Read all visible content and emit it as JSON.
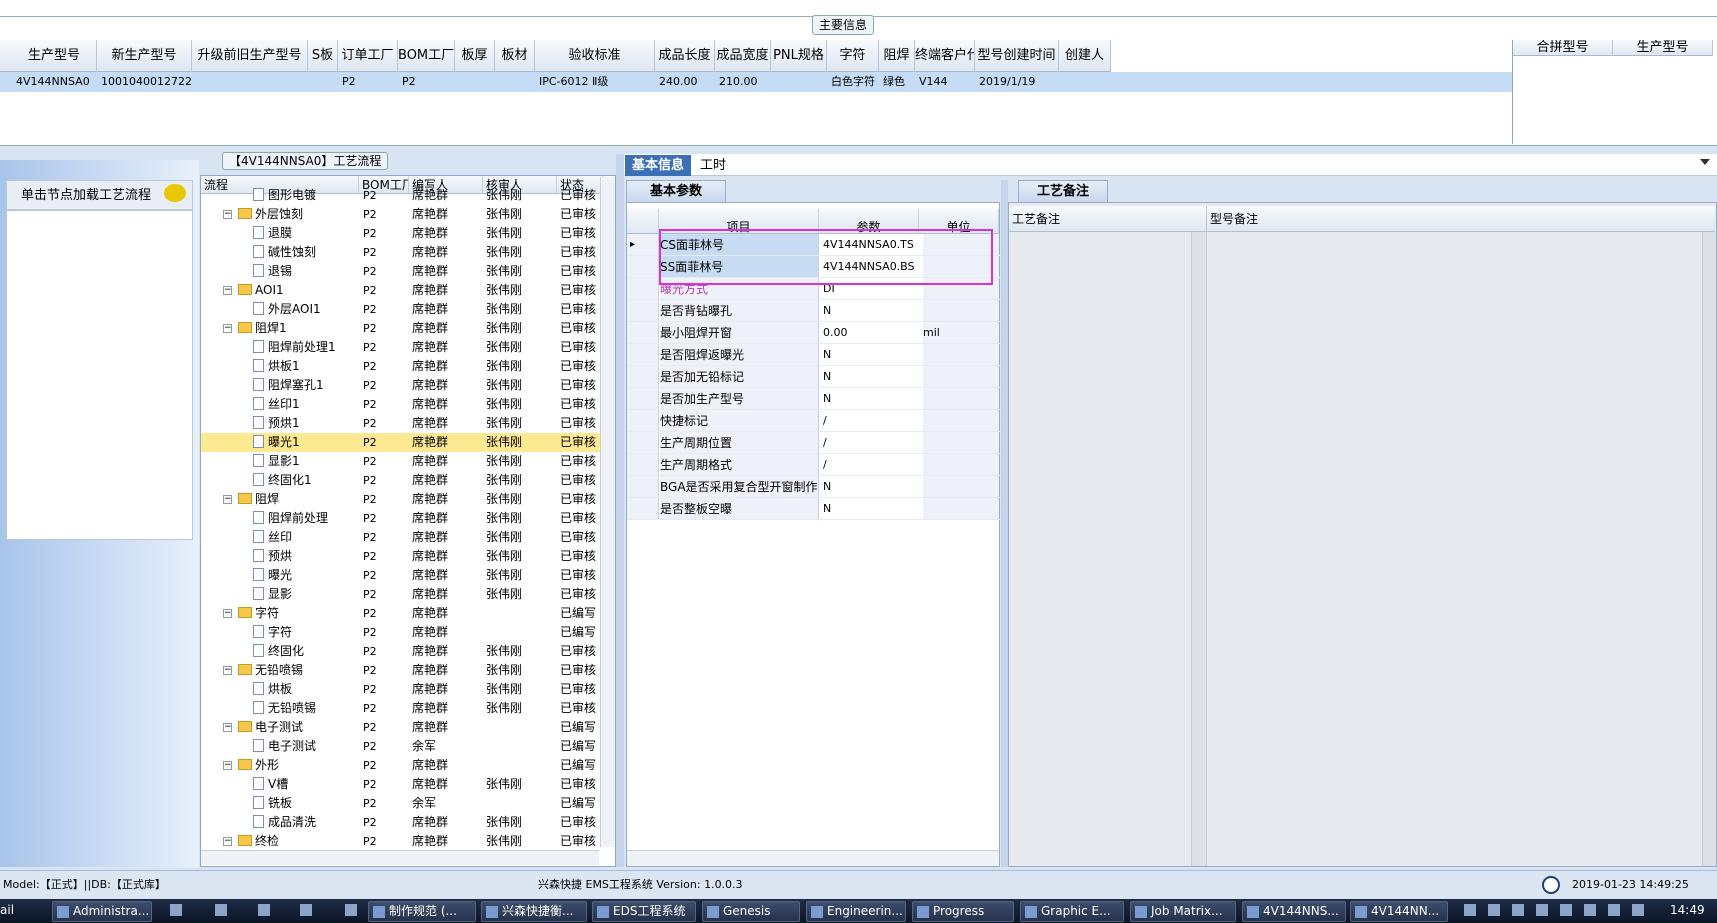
{
  "main_info": {
    "title": "主要信息",
    "headers": [
      "生产型号",
      "新生产型号",
      "升级前旧生产型号",
      "S板",
      "订单工厂",
      "BOM工厂",
      "板厚",
      "板材",
      "验收标准",
      "成品长度",
      "成品宽度",
      "PNL规格",
      "字符",
      "阻焊",
      "终端客户代码",
      "型号创建时间",
      "创建人"
    ],
    "row": [
      "4V144NNSA0",
      "10010400127223",
      "",
      "",
      "P2",
      "P2",
      "",
      "",
      "IPC-6012 Ⅱ级",
      "240.00",
      "210.00",
      "",
      "白色字符",
      "绿色",
      "V144",
      "2019/1/19",
      ""
    ],
    "side_headers": [
      "合拼型号",
      "生产型号"
    ]
  },
  "left_panel": {
    "load_button": "单击节点加载工艺流程",
    "bubble_icon": "speech-bubble-icon"
  },
  "tree": {
    "title": "【4V144NNSA0】工艺流程",
    "headers": [
      "流程",
      "BOM工厂",
      "编写人",
      "核审人",
      "状态"
    ],
    "rows": [
      {
        "name": "图形电镀",
        "level": 2,
        "bom": "P2",
        "writer": "席艳群",
        "reviewer": "张伟刚",
        "status": "已审核"
      },
      {
        "name": "外层蚀刻",
        "level": 1,
        "bom": "P2",
        "writer": "席艳群",
        "reviewer": "张伟刚",
        "status": "已审核"
      },
      {
        "name": "退膜",
        "level": 2,
        "bom": "P2",
        "writer": "席艳群",
        "reviewer": "张伟刚",
        "status": "已审核"
      },
      {
        "name": "碱性蚀刻",
        "level": 2,
        "bom": "P2",
        "writer": "席艳群",
        "reviewer": "张伟刚",
        "status": "已审核"
      },
      {
        "name": "退锡",
        "level": 2,
        "bom": "P2",
        "writer": "席艳群",
        "reviewer": "张伟刚",
        "status": "已审核"
      },
      {
        "name": "AOI1",
        "level": 1,
        "bom": "P2",
        "writer": "席艳群",
        "reviewer": "张伟刚",
        "status": "已审核"
      },
      {
        "name": "外层AOI1",
        "level": 2,
        "bom": "P2",
        "writer": "席艳群",
        "reviewer": "张伟刚",
        "status": "已审核"
      },
      {
        "name": "阻焊1",
        "level": 1,
        "bom": "P2",
        "writer": "席艳群",
        "reviewer": "张伟刚",
        "status": "已审核"
      },
      {
        "name": "阻焊前处理1",
        "level": 2,
        "bom": "P2",
        "writer": "席艳群",
        "reviewer": "张伟刚",
        "status": "已审核"
      },
      {
        "name": "烘板1",
        "level": 2,
        "bom": "P2",
        "writer": "席艳群",
        "reviewer": "张伟刚",
        "status": "已审核"
      },
      {
        "name": "阻焊塞孔1",
        "level": 2,
        "bom": "P2",
        "writer": "席艳群",
        "reviewer": "张伟刚",
        "status": "已审核"
      },
      {
        "name": "丝印1",
        "level": 2,
        "bom": "P2",
        "writer": "席艳群",
        "reviewer": "张伟刚",
        "status": "已审核"
      },
      {
        "name": "预烘1",
        "level": 2,
        "bom": "P2",
        "writer": "席艳群",
        "reviewer": "张伟刚",
        "status": "已审核"
      },
      {
        "name": "曝光1",
        "level": 2,
        "bom": "P2",
        "writer": "席艳群",
        "reviewer": "张伟刚",
        "status": "已审核",
        "selected": true
      },
      {
        "name": "显影1",
        "level": 2,
        "bom": "P2",
        "writer": "席艳群",
        "reviewer": "张伟刚",
        "status": "已审核"
      },
      {
        "name": "终固化1",
        "level": 2,
        "bom": "P2",
        "writer": "席艳群",
        "reviewer": "张伟刚",
        "status": "已审核"
      },
      {
        "name": "阻焊",
        "level": 1,
        "bom": "P2",
        "writer": "席艳群",
        "reviewer": "张伟刚",
        "status": "已审核"
      },
      {
        "name": "阻焊前处理",
        "level": 2,
        "bom": "P2",
        "writer": "席艳群",
        "reviewer": "张伟刚",
        "status": "已审核"
      },
      {
        "name": "丝印",
        "level": 2,
        "bom": "P2",
        "writer": "席艳群",
        "reviewer": "张伟刚",
        "status": "已审核"
      },
      {
        "name": "预烘",
        "level": 2,
        "bom": "P2",
        "writer": "席艳群",
        "reviewer": "张伟刚",
        "status": "已审核"
      },
      {
        "name": "曝光",
        "level": 2,
        "bom": "P2",
        "writer": "席艳群",
        "reviewer": "张伟刚",
        "status": "已审核"
      },
      {
        "name": "显影",
        "level": 2,
        "bom": "P2",
        "writer": "席艳群",
        "reviewer": "张伟刚",
        "status": "已审核"
      },
      {
        "name": "字符",
        "level": 1,
        "bom": "P2",
        "writer": "席艳群",
        "reviewer": "",
        "status": "已编写"
      },
      {
        "name": "字符",
        "level": 2,
        "bom": "P2",
        "writer": "席艳群",
        "reviewer": "",
        "status": "已编写"
      },
      {
        "name": "终固化",
        "level": 2,
        "bom": "P2",
        "writer": "席艳群",
        "reviewer": "张伟刚",
        "status": "已审核"
      },
      {
        "name": "无铅喷锡",
        "level": 1,
        "bom": "P2",
        "writer": "席艳群",
        "reviewer": "张伟刚",
        "status": "已审核"
      },
      {
        "name": "烘板",
        "level": 2,
        "bom": "P2",
        "writer": "席艳群",
        "reviewer": "张伟刚",
        "status": "已审核"
      },
      {
        "name": "无铅喷锡",
        "level": 2,
        "bom": "P2",
        "writer": "席艳群",
        "reviewer": "张伟刚",
        "status": "已审核"
      },
      {
        "name": "电子测试",
        "level": 1,
        "bom": "P2",
        "writer": "席艳群",
        "reviewer": "",
        "status": "已编写"
      },
      {
        "name": "电子测试",
        "level": 2,
        "bom": "P2",
        "writer": "余军",
        "reviewer": "",
        "status": "已编写"
      },
      {
        "name": "外形",
        "level": 1,
        "bom": "P2",
        "writer": "席艳群",
        "reviewer": "",
        "status": "已编写"
      },
      {
        "name": "V槽",
        "level": 2,
        "bom": "P2",
        "writer": "席艳群",
        "reviewer": "张伟刚",
        "status": "已审核"
      },
      {
        "name": "铣板",
        "level": 2,
        "bom": "P2",
        "writer": "余军",
        "reviewer": "",
        "status": "已编写"
      },
      {
        "name": "成品清洗",
        "level": 2,
        "bom": "P2",
        "writer": "席艳群",
        "reviewer": "张伟刚",
        "status": "已审核"
      },
      {
        "name": "终检",
        "level": 1,
        "bom": "P2",
        "writer": "席艳群",
        "reviewer": "张伟刚",
        "status": "已审核"
      }
    ]
  },
  "tabs": {
    "basic_info": "基本信息",
    "hours": "工时"
  },
  "params": {
    "tab": "基本参数",
    "headers": [
      "项目",
      "参数",
      "单位"
    ],
    "rows": [
      {
        "item": "CS面菲林号",
        "value": "4V144NNSA0.TS",
        "unit": ""
      },
      {
        "item": "SS面菲林号",
        "value": "4V144NNSA0.BS",
        "unit": ""
      },
      {
        "item": "曝光方式",
        "value": "DI",
        "unit": ""
      },
      {
        "item": "是否背钻曝孔",
        "value": "N",
        "unit": ""
      },
      {
        "item": "最小阻焊开窗",
        "value": "0.00",
        "unit": "mil"
      },
      {
        "item": "是否阻焊返曝光",
        "value": "N",
        "unit": ""
      },
      {
        "item": "是否加无铅标记",
        "value": "N",
        "unit": ""
      },
      {
        "item": "是否加生产型号",
        "value": "N",
        "unit": ""
      },
      {
        "item": "快捷标记",
        "value": "/",
        "unit": ""
      },
      {
        "item": "生产周期位置",
        "value": "/",
        "unit": ""
      },
      {
        "item": "生产周期格式",
        "value": "/",
        "unit": ""
      },
      {
        "item": "BGA是否采用复合型开窗制作",
        "value": "N",
        "unit": ""
      },
      {
        "item": "是否整板空曝",
        "value": "N",
        "unit": ""
      }
    ],
    "highlight_color": "#d733d3"
  },
  "remarks": {
    "tab": "工艺备注",
    "headers": [
      "工艺备注",
      "型号备注"
    ]
  },
  "status": {
    "left": "Model:【正式】||DB:【正式库】",
    "center": "兴森快捷  EMS工程系统  Version: 1.0.0.3",
    "datetime": "2019-01-23 14:49:25"
  },
  "taskbar": {
    "start_fragment": "ail",
    "items": [
      "Administra...",
      "制作规范 (...",
      "兴森快捷衡...",
      "EDS工程系统",
      "Genesis",
      "Engineerin...",
      "Progress",
      "Graphic E...",
      "Job Matrix...",
      "4V144NNS...",
      "4V144NN..."
    ],
    "time": "14:49"
  }
}
